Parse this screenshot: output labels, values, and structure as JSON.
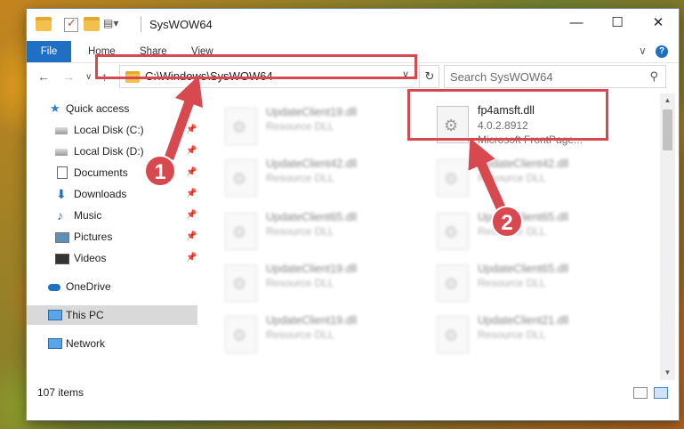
{
  "window": {
    "title": "SysWOW64",
    "buttons": {
      "minimize": "—",
      "maximize": "☐",
      "close": "✕"
    }
  },
  "ribbon": {
    "tabs": [
      "File",
      "Home",
      "Share",
      "View"
    ],
    "expand": "∨",
    "help": "?"
  },
  "nav": {
    "back": "←",
    "forward": "→",
    "recent": "∨",
    "up": "↑"
  },
  "address": {
    "path": "C:\\Windows\\SysWOW64",
    "dropdown": "∨",
    "refresh": "↻"
  },
  "search": {
    "placeholder": "Search SysWOW64",
    "icon": "⚲"
  },
  "navpane": {
    "items": [
      {
        "label": "Quick access",
        "icon": "star-icon"
      },
      {
        "label": "Local Disk (C:)",
        "icon": "drive-icon",
        "pinned": true
      },
      {
        "label": "Local Disk (D:)",
        "icon": "drive-icon",
        "pinned": true
      },
      {
        "label": "Documents",
        "icon": "documents-icon",
        "pinned": true
      },
      {
        "label": "Downloads",
        "icon": "download-icon",
        "pinned": true
      },
      {
        "label": "Music",
        "icon": "music-icon",
        "pinned": true
      },
      {
        "label": "Pictures",
        "icon": "pictures-icon",
        "pinned": true
      },
      {
        "label": "Videos",
        "icon": "videos-icon",
        "pinned": true
      },
      {
        "label": "OneDrive",
        "icon": "cloud-icon"
      },
      {
        "label": "This PC",
        "icon": "computer-icon",
        "selected": true
      },
      {
        "label": "Network",
        "icon": "network-icon"
      }
    ]
  },
  "files": {
    "highlighted": {
      "name": "fp4amsft.dll",
      "version": "4.0.2.8912",
      "desc": "Microsoft FrontPage..."
    },
    "left_column": [
      {
        "name": "UpdateClient19.dll",
        "desc": "Resource DLL"
      },
      {
        "name": "UpdateClient42.dll",
        "desc": "Resource DLL"
      },
      {
        "name": "UpdateClient65.dll",
        "desc": "Resource DLL"
      },
      {
        "name": "UpdateClient19.dll",
        "desc": "Resource DLL"
      },
      {
        "name": "UpdateClient19.dll",
        "desc": "Resource DLL"
      }
    ],
    "right_column": [
      {
        "name": "UpdateClient42.dll",
        "desc": "Resource DLL"
      },
      {
        "name": "UpdateClient65.dll",
        "desc": "Resource DLL"
      },
      {
        "name": "UpdateClient65.dll",
        "desc": "Resource DLL"
      },
      {
        "name": "UpdateClient21.dll",
        "desc": "Resource DLL"
      }
    ]
  },
  "status": {
    "count": "107 items"
  },
  "annotations": {
    "step1": "1",
    "step2": "2",
    "color": "#d8484f"
  }
}
